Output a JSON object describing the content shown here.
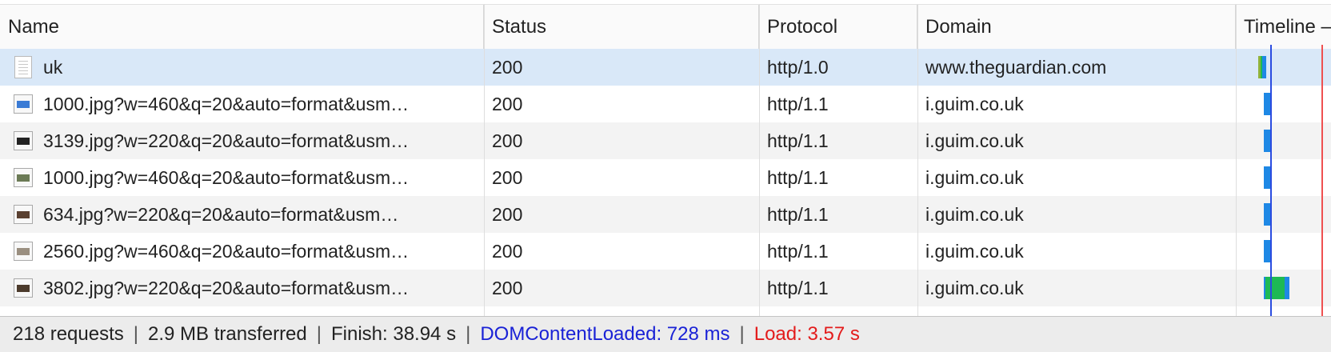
{
  "columns": {
    "name": "Name",
    "status": "Status",
    "protocol": "Protocol",
    "domain": "Domain",
    "timeline": "Timeline –"
  },
  "rows": [
    {
      "name": "uk",
      "status": "200",
      "protocol": "http/1.0",
      "domain": "www.theguardian.com",
      "icon": "document-icon",
      "selected": true
    },
    {
      "name": "1000.jpg?w=460&q=20&auto=format&usm…",
      "status": "200",
      "protocol": "http/1.1",
      "domain": "i.guim.co.uk",
      "icon": "image-icon",
      "selected": false
    },
    {
      "name": "3139.jpg?w=220&q=20&auto=format&usm…",
      "status": "200",
      "protocol": "http/1.1",
      "domain": "i.guim.co.uk",
      "icon": "image-icon",
      "selected": false
    },
    {
      "name": "1000.jpg?w=460&q=20&auto=format&usm…",
      "status": "200",
      "protocol": "http/1.1",
      "domain": "i.guim.co.uk",
      "icon": "image-icon",
      "selected": false
    },
    {
      "name": "634.jpg?w=220&q=20&auto=format&usm…",
      "status": "200",
      "protocol": "http/1.1",
      "domain": "i.guim.co.uk",
      "icon": "image-icon",
      "selected": false
    },
    {
      "name": "2560.jpg?w=460&q=20&auto=format&usm…",
      "status": "200",
      "protocol": "http/1.1",
      "domain": "i.guim.co.uk",
      "icon": "image-icon",
      "selected": false
    },
    {
      "name": "3802.jpg?w=220&q=20&auto=format&usm…",
      "status": "200",
      "protocol": "http/1.1",
      "domain": "i.guim.co.uk",
      "icon": "image-icon",
      "selected": false
    }
  ],
  "footer": {
    "requests": "218 requests",
    "transferred": "2.9 MB transferred",
    "finish": "Finish: 38.94 s",
    "dom_content_loaded": "DOMContentLoaded: 728 ms",
    "load": "Load: 3.57 s"
  },
  "colors": {
    "selected_row": "#d9e8f8",
    "dom_content_loaded": "#1a22d6",
    "load": "#e31b1b",
    "timeline_blue": "#1e88e5",
    "timeline_green": "#1db954"
  }
}
